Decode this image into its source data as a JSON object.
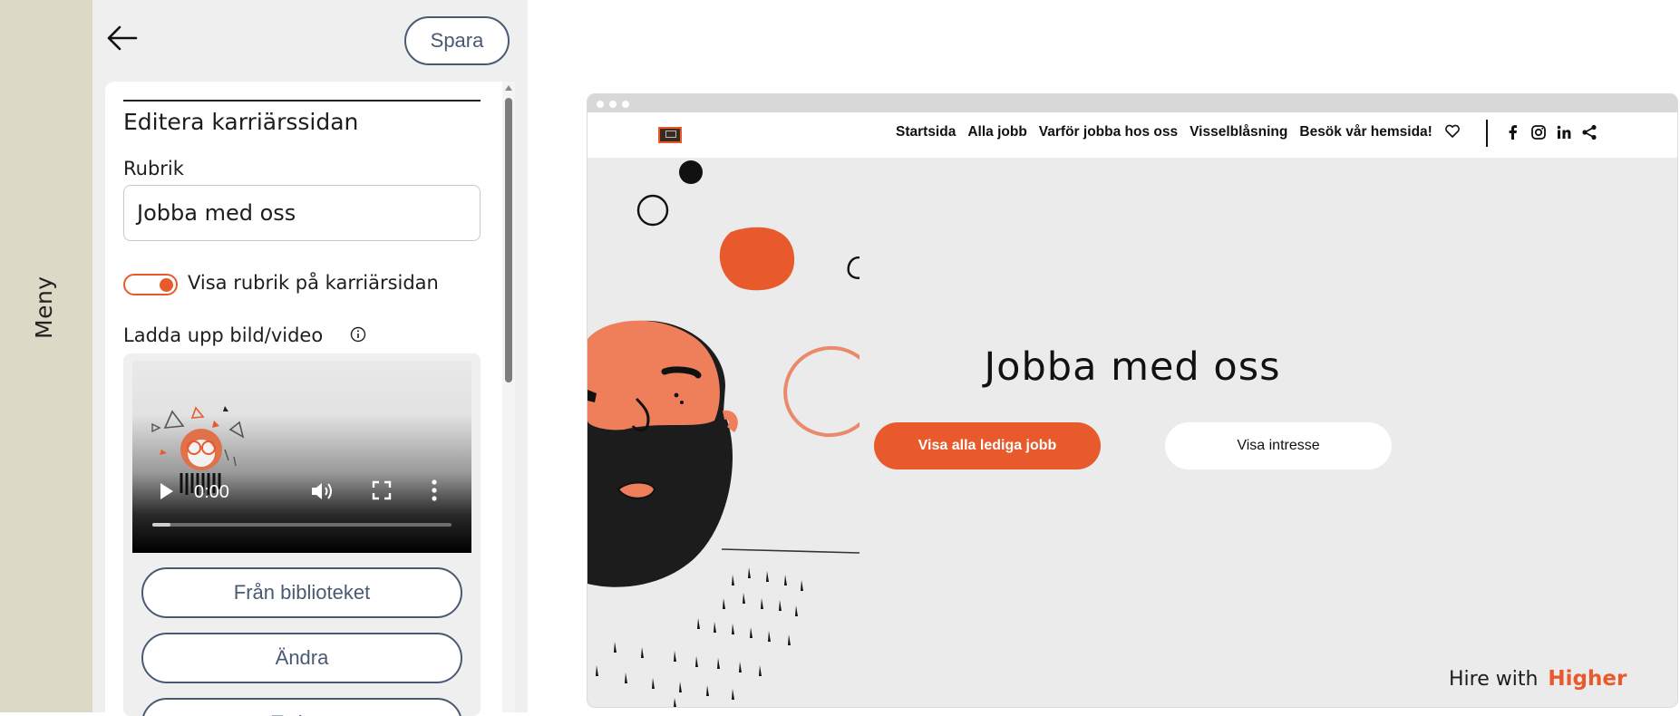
{
  "rail": {
    "label": "Meny"
  },
  "panel": {
    "save_label": "Spara",
    "title": "Editera karriärssidan",
    "heading_label": "Rubrik",
    "heading_value": "Jobba med oss",
    "toggle_label": "Visa rubrik på karriärsidan",
    "toggle_on": true,
    "upload_label": "Ladda upp bild/video",
    "video": {
      "time": "0:00",
      "progress": 0.06
    },
    "buttons": [
      "Från biblioteket",
      "Ändra",
      "Ta bort"
    ]
  },
  "preview": {
    "nav_links": [
      "Startsida",
      "Alla jobb",
      "Varför jobba hos oss",
      "Visselblåsning",
      "Besök vår hemsida!"
    ],
    "social_icons": [
      "facebook-icon",
      "instagram-icon",
      "linkedin-icon",
      "share-icon"
    ],
    "hero_title": "Jobba med oss",
    "primary_button": "Visa alla lediga jobb",
    "secondary_button": "Visa intresse",
    "footer_prefix": "Hire with",
    "footer_brand": "Higher"
  },
  "colors": {
    "accent": "#e8592c",
    "button_outline": "#4a5a73",
    "rail": "#ddd9c7",
    "preview_bg": "#ebebeb"
  }
}
